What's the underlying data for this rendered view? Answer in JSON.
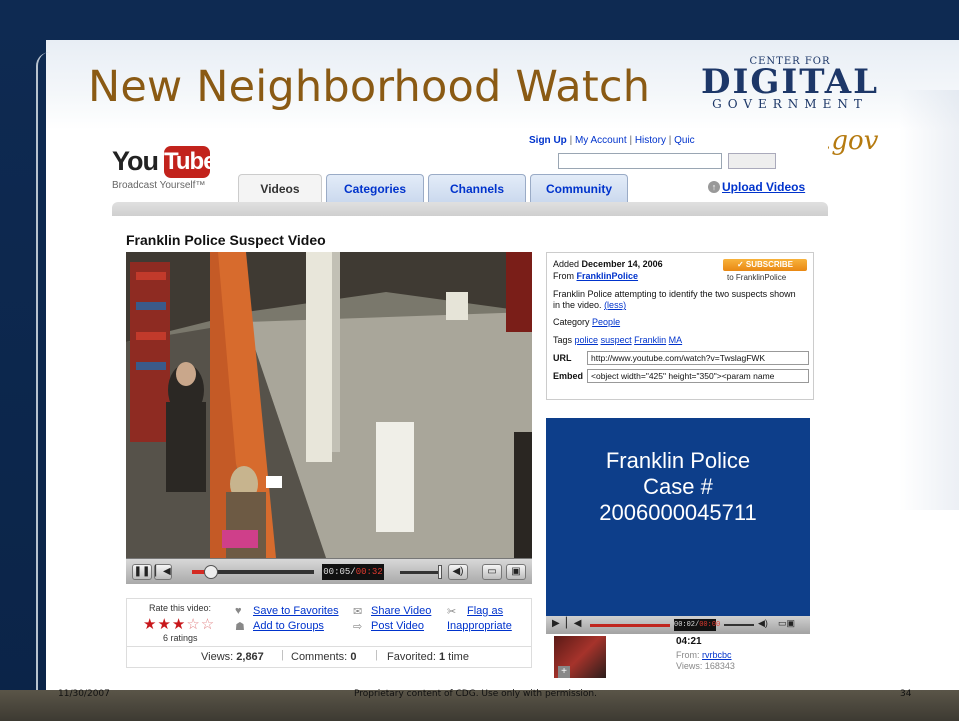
{
  "slide": {
    "title": "New Neighborhood Watch",
    "logo": {
      "line1": "CENTER FOR",
      "line2": "DIGITAL",
      "line3": "GOVERNMENT"
    },
    "tagline": "Simple.gov",
    "footer": {
      "date": "11/30/2007",
      "note": "Proprietary content of CDG. Use only with permission.",
      "page": "34"
    }
  },
  "youtube": {
    "logo": {
      "you": "You",
      "tube": "Tube",
      "slogan": "Broadcast Yourself™"
    },
    "toplinks": {
      "signup": "Sign Up",
      "account": "My Account",
      "history": "History",
      "quick": "Quic",
      "sep": "|"
    },
    "tabs": [
      "Videos",
      "Categories",
      "Channels",
      "Community"
    ],
    "upload": "Upload Videos",
    "video": {
      "title": "Franklin Police Suspect Video",
      "time_current": "00:05",
      "time_total": "00:32",
      "time_sep": "/",
      "progress": 0.16
    },
    "rating": {
      "label": "Rate this video:",
      "stars_filled": "★★★",
      "stars_empty": "☆☆",
      "count": "6 ratings"
    },
    "actions": {
      "favorites": "Save to Favorites",
      "groups": "Add to Groups",
      "share": "Share Video",
      "post": "Post Video",
      "flag_line1": "Flag as",
      "flag_line2": "Inappropriate"
    },
    "stats": {
      "views_label": "Views:",
      "views": "2,867",
      "comments_label": "Comments:",
      "comments": "0",
      "favorited_label": "Favorited:",
      "favorited": "1",
      "favorited_suffix": "time"
    },
    "info": {
      "added_label": "Added",
      "added_date": "December 14, 2006",
      "from_label": "From",
      "from_user": "FranklinPolice",
      "subscribe": "✓ SUBSCRIBE",
      "subscribe_to": "to FranklinPolice",
      "description": "Franklin Police attempting to identify the two suspects shown in the video.",
      "less": "(less)",
      "category_label": "Category",
      "category": "People",
      "tags_label": "Tags",
      "tags": [
        "police",
        "suspect",
        "Franklin",
        "MA"
      ],
      "url_label": "URL",
      "url": "http://www.youtube.com/watch?v=TwslagFWK",
      "embed_label": "Embed",
      "embed": "<object width=\"425\" height=\"350\"><param name"
    },
    "related": {
      "line1": "Franklin Police",
      "line2": "Case #",
      "line3": "2006000045711",
      "time_current": "00:02",
      "time_total": "00:00",
      "item": {
        "duration": "04:21",
        "from_label": "From:",
        "from_user": "rvrbcbc",
        "views_label": "Views:",
        "views": "168343"
      }
    }
  }
}
